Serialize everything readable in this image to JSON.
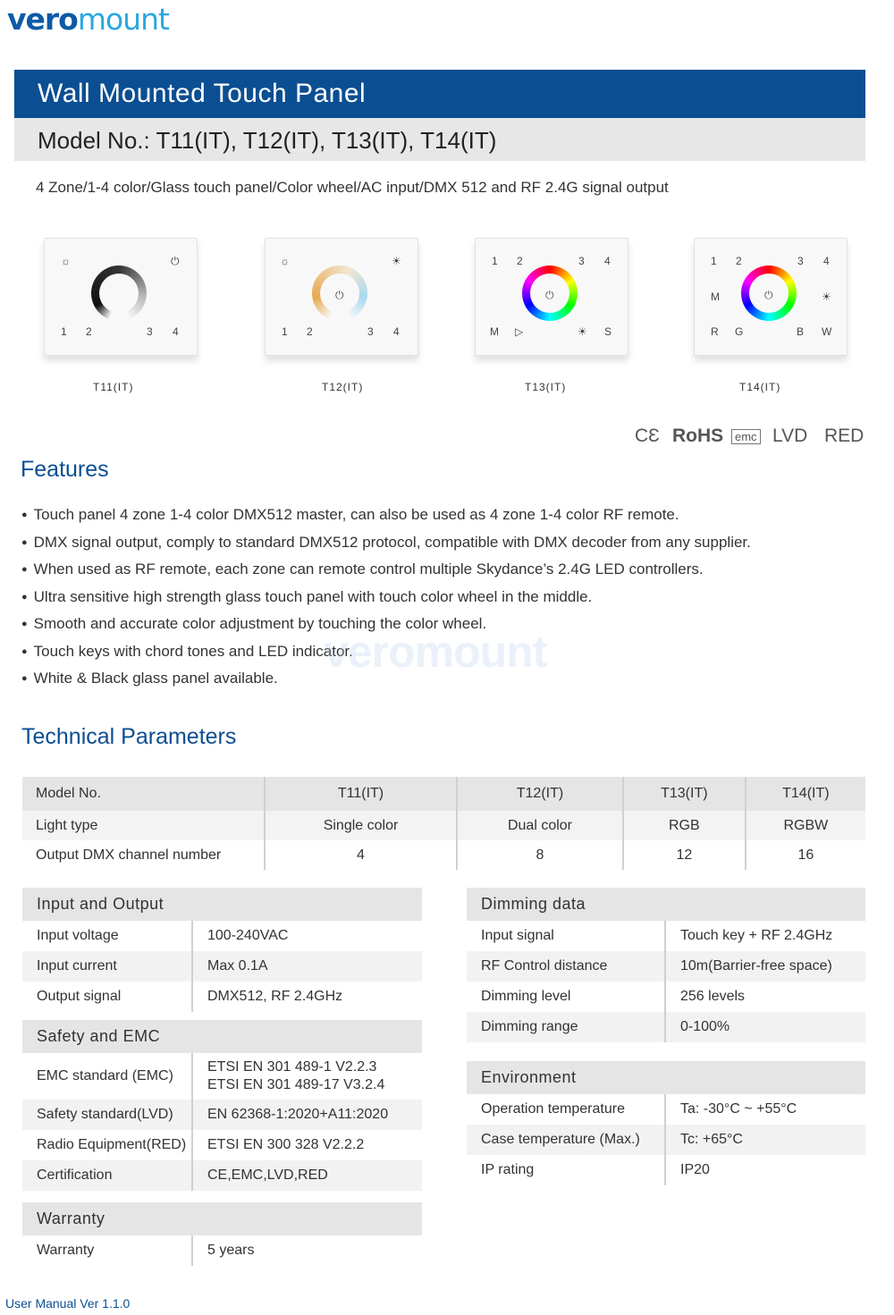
{
  "brand": {
    "part1": "vero",
    "part2": "mount"
  },
  "header": {
    "title": "Wall Mounted Touch Panel",
    "model": "Model No.: T11(IT), T12(IT), T13(IT), T14(IT)"
  },
  "subtitle": "4 Zone/1-4 color/Glass touch panel/Color wheel/AC input/DMX 512 and RF 2.4G signal output",
  "panels": [
    {
      "label": "T11(IT)",
      "keys": [
        "☼",
        "⏻",
        "1",
        "2",
        "3",
        "4"
      ]
    },
    {
      "label": "T12(IT)",
      "keys": [
        "☼",
        "☀",
        "1",
        "2",
        "3",
        "4"
      ]
    },
    {
      "label": "T13(IT)",
      "keys": [
        "1",
        "2",
        "3",
        "4",
        "M",
        "▷",
        "☀",
        "S"
      ]
    },
    {
      "label": "T14(IT)",
      "keys": [
        "1",
        "2",
        "3",
        "4",
        "M",
        "☀",
        "R",
        "G",
        "B",
        "W"
      ]
    }
  ],
  "power_symbol": "⏻",
  "certs": {
    "ce": "CƐ",
    "rohs": "RoHS",
    "emc": "emc",
    "lvd": "LVD",
    "red": "RED"
  },
  "features": {
    "heading": "Features",
    "items": [
      "Touch panel 4 zone 1-4 color DMX512 master, can also be used as 4 zone 1-4 color RF remote.",
      "DMX signal output, comply to standard DMX512 protocol, compatible with DMX decoder from any supplier.",
      "When used as RF remote, each zone can remote control multiple Skydance’s 2.4G LED controllers.",
      "Ultra sensitive high strength glass touch panel with touch color wheel in the middle.",
      "Smooth and accurate color adjustment by touching the color wheel.",
      "Touch keys with chord tones and LED indicator.",
      "White & Black glass panel available."
    ]
  },
  "tech": {
    "heading": "Technical Parameters",
    "header": [
      "Model No.",
      "T11(IT)",
      "T12(IT)",
      "T13(IT)",
      "T14(IT)"
    ],
    "rows": [
      [
        "Light type",
        "Single color",
        "Dual color",
        "RGB",
        "RGBW"
      ],
      [
        "Output DMX channel number",
        "4",
        "8",
        "12",
        "16"
      ]
    ]
  },
  "input_output": {
    "heading": "Input and Output",
    "rows": [
      [
        "Input voltage",
        "100-240VAC"
      ],
      [
        "Input current",
        "Max 0.1A"
      ],
      [
        "Output signal",
        "DMX512, RF 2.4GHz"
      ]
    ]
  },
  "safety": {
    "heading": "Safety and EMC",
    "emc_label": "EMC standard (EMC)",
    "emc_value_1": "ETSI EN 301 489-1 V2.2.3",
    "emc_value_2": "ETSI EN 301 489-17 V3.2.4",
    "rows": [
      [
        "Safety standard(LVD)",
        "EN 62368-1:2020+A11:2020"
      ],
      [
        "Radio Equipment(RED)",
        "ETSI EN 300 328 V2.2.2"
      ],
      [
        "Certification",
        "CE,EMC,LVD,RED"
      ]
    ]
  },
  "warranty": {
    "heading": "Warranty",
    "rows": [
      [
        "Warranty",
        "5 years"
      ]
    ]
  },
  "dimming": {
    "heading": "Dimming data",
    "rows": [
      [
        "Input signal",
        "Touch key + RF 2.4GHz"
      ],
      [
        "RF Control distance",
        "10m(Barrier-free space)"
      ],
      [
        "Dimming level",
        "256 levels"
      ],
      [
        "Dimming range",
        "0-100%"
      ]
    ]
  },
  "environment": {
    "heading": "Environment",
    "rows": [
      [
        "Operation temperature",
        "Ta: -30°C ~ +55°C"
      ],
      [
        "Case temperature (Max.)",
        "Tc: +65°C"
      ],
      [
        "IP rating",
        "IP20"
      ]
    ]
  },
  "footer": "User Manual Ver 1.1.0"
}
